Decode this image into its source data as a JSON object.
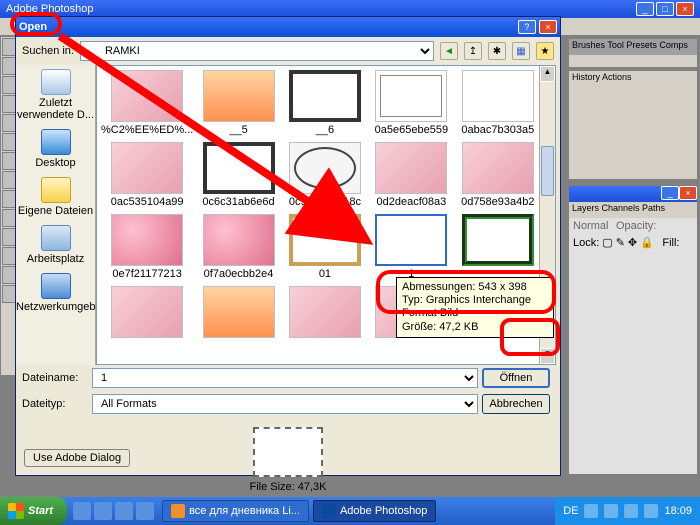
{
  "app": {
    "title": "Adobe Photoshop"
  },
  "palettes": {
    "top_tabs": "Brushes  Tool Presets  Comps",
    "mid_tabs": "History  Actions",
    "bot_tabs": "Layers  Channels  Paths",
    "mode": "Normal",
    "opacity_label": "Opacity:",
    "lock_label": "Lock:",
    "fill_label": "Fill:"
  },
  "dialog": {
    "title": "Open",
    "lookin_label": "Suchen in:",
    "lookin_value": "RAMKI",
    "places": [
      "Zuletzt verwendete D...",
      "Desktop",
      "Eigene Dateien",
      "Arbeitsplatz",
      "Netzwerkumgebung"
    ],
    "files": [
      {
        "name": "%C2%EE%ED%...",
        "cls": "f1"
      },
      {
        "name": "__5",
        "cls": "f2"
      },
      {
        "name": "__6",
        "cls": "fb"
      },
      {
        "name": "0a5e65ebe559",
        "cls": "curl"
      },
      {
        "name": "0abac7b303a5",
        "cls": "f3"
      },
      {
        "name": "0ac535104a99",
        "cls": "f1"
      },
      {
        "name": "0c6c31ab6e6d",
        "cls": "fb"
      },
      {
        "name": "0c953062a18c",
        "cls": "oval"
      },
      {
        "name": "0d2deacf08a3",
        "cls": "f1"
      },
      {
        "name": "0d758e93a4b2",
        "cls": "f1"
      },
      {
        "name": "0e7f21177213",
        "cls": "heart"
      },
      {
        "name": "0f7a0ecbb2e4",
        "cls": "heart"
      },
      {
        "name": "01",
        "cls": "fg"
      },
      {
        "name": "1",
        "cls": "dashed",
        "selected": true
      },
      {
        "name": "",
        "cls": "green"
      },
      {
        "name": "",
        "cls": "f1"
      },
      {
        "name": "",
        "cls": "f2"
      },
      {
        "name": "",
        "cls": "f1"
      },
      {
        "name": "",
        "cls": "f1"
      },
      {
        "name": "",
        "cls": "f1"
      }
    ],
    "filename_label": "Dateiname:",
    "filename_value": "1",
    "filetype_label": "Dateityp:",
    "filetype_value": "All Formats",
    "open_btn": "Öffnen",
    "cancel_btn": "Abbrechen",
    "preview_label": "File Size: 47,3K",
    "use_adobe": "Use Adobe Dialog"
  },
  "tooltip": {
    "line1": "Abmessungen: 543 x 398",
    "line2": "Typ: Graphics Interchange Format Bild",
    "line3": "Größe: 47,2 KB"
  },
  "taskbar": {
    "start": "Start",
    "task1": "все для дневника Li...",
    "task2": "Adobe Photoshop",
    "lang": "DE",
    "clock": "18:09"
  }
}
